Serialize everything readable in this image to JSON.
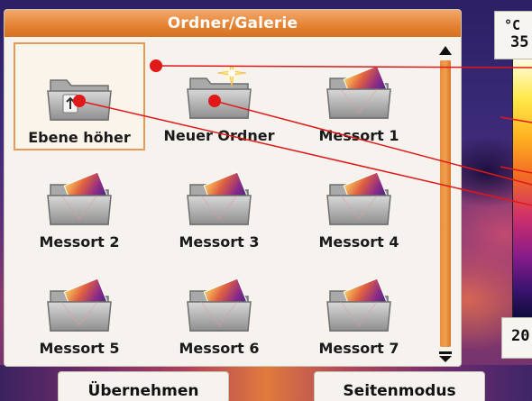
{
  "window": {
    "title": "Ordner/Galerie"
  },
  "folders": [
    {
      "label": "Ebene höher",
      "icon": "folder-up-icon",
      "selected": true
    },
    {
      "label": "Neuer Ordner",
      "icon": "new-folder-icon",
      "selected": false
    },
    {
      "label": "Messort 1",
      "icon": "thermal-folder-icon",
      "selected": false
    },
    {
      "label": "Messort 2",
      "icon": "thermal-folder-icon",
      "selected": false
    },
    {
      "label": "Messort 3",
      "icon": "thermal-folder-icon",
      "selected": false
    },
    {
      "label": "Messort 4",
      "icon": "thermal-folder-icon",
      "selected": false
    },
    {
      "label": "Messort 5",
      "icon": "thermal-folder-icon",
      "selected": false
    },
    {
      "label": "Messort 6",
      "icon": "thermal-folder-icon",
      "selected": false
    },
    {
      "label": "Messort 7",
      "icon": "thermal-folder-icon",
      "selected": false
    }
  ],
  "temperature_scale": {
    "unit": "°C",
    "max_visible": "35",
    "min_visible": "20"
  },
  "buttons": {
    "accept": "Übernehmen",
    "page_mode": "Seitenmodus"
  },
  "colors": {
    "accent": "#e58436",
    "selection_border": "#e89a55",
    "annotation": "#e01818"
  }
}
